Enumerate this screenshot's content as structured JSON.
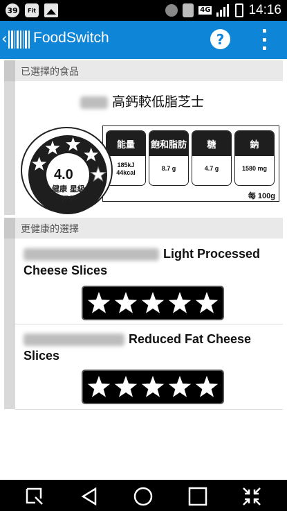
{
  "status_bar": {
    "notif_count": "39",
    "notif_app": "Fit",
    "network": "4G",
    "time": "14:16"
  },
  "app_bar": {
    "title": "FoodSwitch",
    "help_label": "?"
  },
  "selected_section": {
    "header": "已選擇的食品",
    "product_name": "高鈣較低脂芝士",
    "health_star_rating": {
      "value": "4.0",
      "label": "健康 星級 評分",
      "stars": 4,
      "max_stars": 5
    },
    "nutrients": [
      {
        "name": "能量",
        "value": "185kJ\n44kcal"
      },
      {
        "name": "飽和脂肪",
        "value": "8.7 g"
      },
      {
        "name": "糖",
        "value": "4.7 g"
      },
      {
        "name": "鈉",
        "value": "1580 mg"
      }
    ],
    "per_label": "每 100g"
  },
  "healthier_section": {
    "header": "更健康的選擇",
    "items": [
      {
        "name": "Light Processed Cheese Slices",
        "stars": 5
      },
      {
        "name": "Reduced Fat Cheese Slices",
        "stars": 5
      }
    ]
  },
  "colors": {
    "app_bar": "#0e85d7",
    "section_header": "#e9e9e9"
  }
}
